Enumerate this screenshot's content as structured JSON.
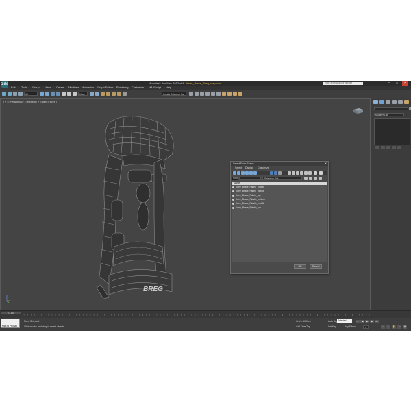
{
  "window": {
    "logo": "3ds",
    "title_prefix": "Autodesk 3ds Max 2012 x64",
    "title_file": "Knee_Brace_Breg_vray.max",
    "search_placeholder": "Type a keyword or phrase",
    "controls": [
      "–",
      "□",
      "✕"
    ]
  },
  "menu": [
    "Edit",
    "Tools",
    "Group",
    "Views",
    "Create",
    "Modifiers",
    "Animation",
    "Graph Editors",
    "Rendering",
    "Customize",
    "MAXScript",
    "Help"
  ],
  "toolbar": {
    "selection_filter": "All",
    "coordinate_system": "View",
    "named_selection": "Create Selection Se"
  },
  "viewport": {
    "label": "[ + ] [ Perspective ] [ Realistic + Edged Faces ]",
    "brand_text": "BREG"
  },
  "command_panel": {
    "name_field": "",
    "modifier_list": "Modifier List"
  },
  "dialog": {
    "title": "Select From Scene",
    "close": "✕",
    "menu": [
      "Select",
      "Display",
      "Customize"
    ],
    "find_label": "Find:",
    "selection_set_label": "Selection Set:",
    "column_header": "Name",
    "objects": [
      "Knee_Brace_Fabric_bottom",
      "Knee_Brace_Fabric_middle",
      "Knee_Brace_Fabric_top",
      "Knee_Brace_Plastic_bottom",
      "Knee_Brace_Plastic_middle",
      "Knee_Brace_Plastic_top"
    ],
    "ok": "OK",
    "cancel": "Cancel"
  },
  "timeline": {
    "slider_text": "0 / 100",
    "tick_labels": [
      "0",
      "5",
      "10",
      "15",
      "20",
      "25",
      "30",
      "35",
      "40",
      "45",
      "50",
      "55",
      "60",
      "65",
      "70",
      "75",
      "80",
      "85",
      "90",
      "95",
      "100"
    ]
  },
  "status": {
    "script_text": "Max to Physac",
    "selection": "None Selected",
    "prompt": "Click or click-and-drag to select objects",
    "grid": "Grid = 10,0cm",
    "add_time_tag": "Add Time Tag",
    "auto_key": "Auto Key",
    "set_key": "Set Key",
    "key_mode": "Selected",
    "key_filters": "Key Filters...",
    "frame": "0"
  }
}
